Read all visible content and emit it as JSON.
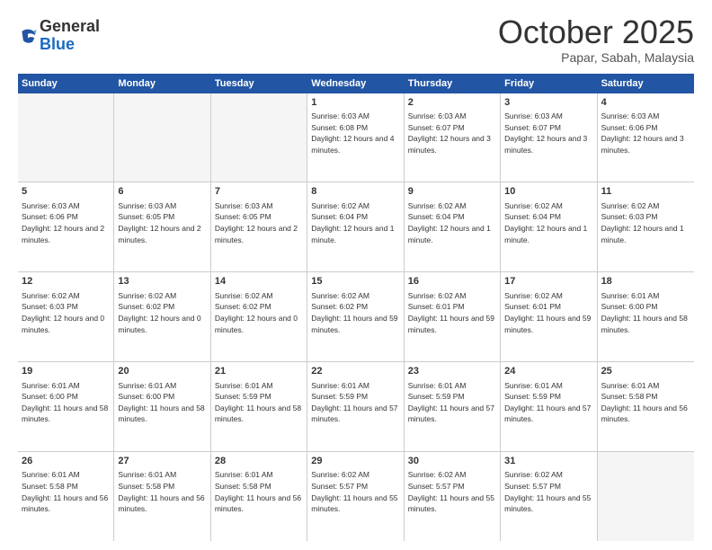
{
  "header": {
    "logo_general": "General",
    "logo_blue": "Blue",
    "month_title": "October 2025",
    "subtitle": "Papar, Sabah, Malaysia"
  },
  "days_of_week": [
    "Sunday",
    "Monday",
    "Tuesday",
    "Wednesday",
    "Thursday",
    "Friday",
    "Saturday"
  ],
  "weeks": [
    [
      {
        "day": "",
        "empty": true
      },
      {
        "day": "",
        "empty": true
      },
      {
        "day": "",
        "empty": true
      },
      {
        "day": "1",
        "sunrise": "Sunrise: 6:03 AM",
        "sunset": "Sunset: 6:08 PM",
        "daylight": "Daylight: 12 hours and 4 minutes."
      },
      {
        "day": "2",
        "sunrise": "Sunrise: 6:03 AM",
        "sunset": "Sunset: 6:07 PM",
        "daylight": "Daylight: 12 hours and 3 minutes."
      },
      {
        "day": "3",
        "sunrise": "Sunrise: 6:03 AM",
        "sunset": "Sunset: 6:07 PM",
        "daylight": "Daylight: 12 hours and 3 minutes."
      },
      {
        "day": "4",
        "sunrise": "Sunrise: 6:03 AM",
        "sunset": "Sunset: 6:06 PM",
        "daylight": "Daylight: 12 hours and 3 minutes."
      }
    ],
    [
      {
        "day": "5",
        "sunrise": "Sunrise: 6:03 AM",
        "sunset": "Sunset: 6:06 PM",
        "daylight": "Daylight: 12 hours and 2 minutes."
      },
      {
        "day": "6",
        "sunrise": "Sunrise: 6:03 AM",
        "sunset": "Sunset: 6:05 PM",
        "daylight": "Daylight: 12 hours and 2 minutes."
      },
      {
        "day": "7",
        "sunrise": "Sunrise: 6:03 AM",
        "sunset": "Sunset: 6:05 PM",
        "daylight": "Daylight: 12 hours and 2 minutes."
      },
      {
        "day": "8",
        "sunrise": "Sunrise: 6:02 AM",
        "sunset": "Sunset: 6:04 PM",
        "daylight": "Daylight: 12 hours and 1 minute."
      },
      {
        "day": "9",
        "sunrise": "Sunrise: 6:02 AM",
        "sunset": "Sunset: 6:04 PM",
        "daylight": "Daylight: 12 hours and 1 minute."
      },
      {
        "day": "10",
        "sunrise": "Sunrise: 6:02 AM",
        "sunset": "Sunset: 6:04 PM",
        "daylight": "Daylight: 12 hours and 1 minute."
      },
      {
        "day": "11",
        "sunrise": "Sunrise: 6:02 AM",
        "sunset": "Sunset: 6:03 PM",
        "daylight": "Daylight: 12 hours and 1 minute."
      }
    ],
    [
      {
        "day": "12",
        "sunrise": "Sunrise: 6:02 AM",
        "sunset": "Sunset: 6:03 PM",
        "daylight": "Daylight: 12 hours and 0 minutes."
      },
      {
        "day": "13",
        "sunrise": "Sunrise: 6:02 AM",
        "sunset": "Sunset: 6:02 PM",
        "daylight": "Daylight: 12 hours and 0 minutes."
      },
      {
        "day": "14",
        "sunrise": "Sunrise: 6:02 AM",
        "sunset": "Sunset: 6:02 PM",
        "daylight": "Daylight: 12 hours and 0 minutes."
      },
      {
        "day": "15",
        "sunrise": "Sunrise: 6:02 AM",
        "sunset": "Sunset: 6:02 PM",
        "daylight": "Daylight: 11 hours and 59 minutes."
      },
      {
        "day": "16",
        "sunrise": "Sunrise: 6:02 AM",
        "sunset": "Sunset: 6:01 PM",
        "daylight": "Daylight: 11 hours and 59 minutes."
      },
      {
        "day": "17",
        "sunrise": "Sunrise: 6:02 AM",
        "sunset": "Sunset: 6:01 PM",
        "daylight": "Daylight: 11 hours and 59 minutes."
      },
      {
        "day": "18",
        "sunrise": "Sunrise: 6:01 AM",
        "sunset": "Sunset: 6:00 PM",
        "daylight": "Daylight: 11 hours and 58 minutes."
      }
    ],
    [
      {
        "day": "19",
        "sunrise": "Sunrise: 6:01 AM",
        "sunset": "Sunset: 6:00 PM",
        "daylight": "Daylight: 11 hours and 58 minutes."
      },
      {
        "day": "20",
        "sunrise": "Sunrise: 6:01 AM",
        "sunset": "Sunset: 6:00 PM",
        "daylight": "Daylight: 11 hours and 58 minutes."
      },
      {
        "day": "21",
        "sunrise": "Sunrise: 6:01 AM",
        "sunset": "Sunset: 5:59 PM",
        "daylight": "Daylight: 11 hours and 58 minutes."
      },
      {
        "day": "22",
        "sunrise": "Sunrise: 6:01 AM",
        "sunset": "Sunset: 5:59 PM",
        "daylight": "Daylight: 11 hours and 57 minutes."
      },
      {
        "day": "23",
        "sunrise": "Sunrise: 6:01 AM",
        "sunset": "Sunset: 5:59 PM",
        "daylight": "Daylight: 11 hours and 57 minutes."
      },
      {
        "day": "24",
        "sunrise": "Sunrise: 6:01 AM",
        "sunset": "Sunset: 5:59 PM",
        "daylight": "Daylight: 11 hours and 57 minutes."
      },
      {
        "day": "25",
        "sunrise": "Sunrise: 6:01 AM",
        "sunset": "Sunset: 5:58 PM",
        "daylight": "Daylight: 11 hours and 56 minutes."
      }
    ],
    [
      {
        "day": "26",
        "sunrise": "Sunrise: 6:01 AM",
        "sunset": "Sunset: 5:58 PM",
        "daylight": "Daylight: 11 hours and 56 minutes."
      },
      {
        "day": "27",
        "sunrise": "Sunrise: 6:01 AM",
        "sunset": "Sunset: 5:58 PM",
        "daylight": "Daylight: 11 hours and 56 minutes."
      },
      {
        "day": "28",
        "sunrise": "Sunrise: 6:01 AM",
        "sunset": "Sunset: 5:58 PM",
        "daylight": "Daylight: 11 hours and 56 minutes."
      },
      {
        "day": "29",
        "sunrise": "Sunrise: 6:02 AM",
        "sunset": "Sunset: 5:57 PM",
        "daylight": "Daylight: 11 hours and 55 minutes."
      },
      {
        "day": "30",
        "sunrise": "Sunrise: 6:02 AM",
        "sunset": "Sunset: 5:57 PM",
        "daylight": "Daylight: 11 hours and 55 minutes."
      },
      {
        "day": "31",
        "sunrise": "Sunrise: 6:02 AM",
        "sunset": "Sunset: 5:57 PM",
        "daylight": "Daylight: 11 hours and 55 minutes."
      },
      {
        "day": "",
        "empty": true
      }
    ]
  ]
}
